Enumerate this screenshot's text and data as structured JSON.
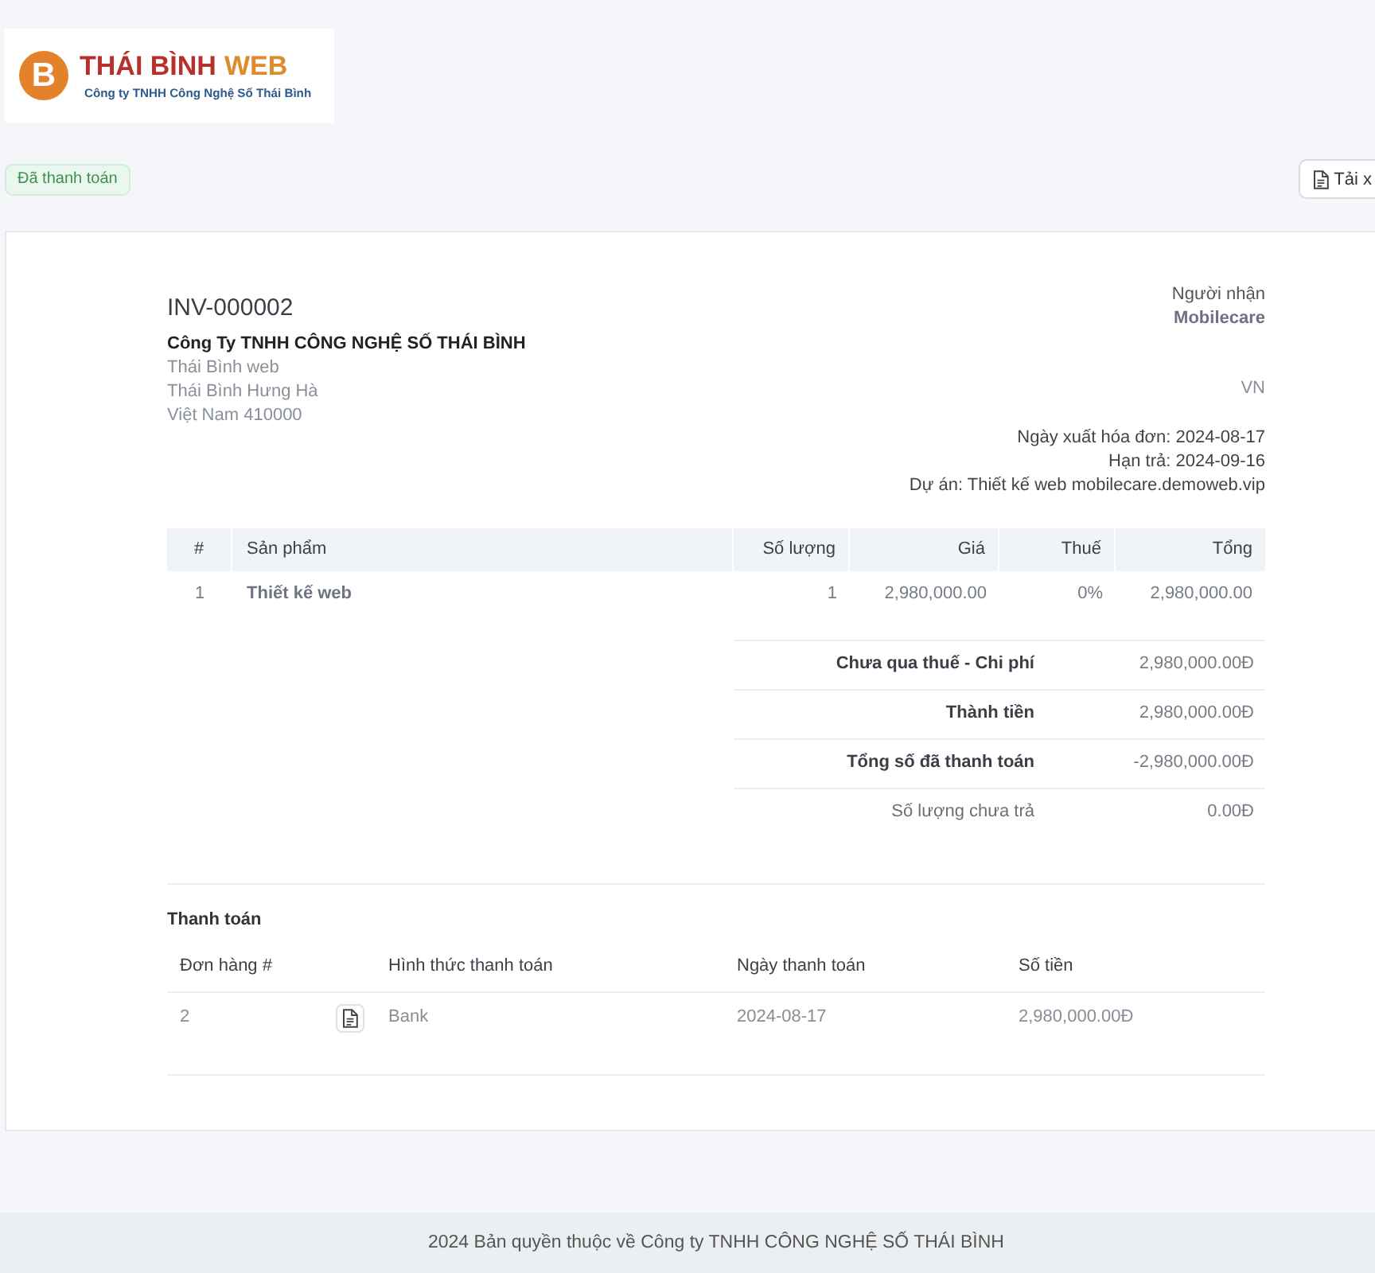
{
  "header": {
    "logo": {
      "mark": "B",
      "title": "THÁI BÌNH",
      "title_accent": "WEB",
      "tagline": "Công ty TNHH Công Nghệ Số Thái Bình"
    },
    "status_badge": "Đã thanh toán",
    "download_button": "Tải x"
  },
  "invoice": {
    "number": "INV-000002",
    "seller": {
      "name": "Công Ty TNHH CÔNG NGHỆ SỐ THÁI BÌNH",
      "address": [
        "Thái Bình web",
        "Thái Bình Hưng Hà",
        "Việt Nam 410000"
      ]
    },
    "recipient": {
      "label": "Người nhận",
      "name": "Mobilecare",
      "country": "VN"
    },
    "details": [
      {
        "label": "Ngày xuất hóa đơn:",
        "value": "2024-08-17"
      },
      {
        "label": "Hạn trả:",
        "value": "2024-09-16"
      },
      {
        "label": "Dự án:",
        "value": "Thiết kế web mobilecare.demoweb.vip"
      }
    ]
  },
  "items_table": {
    "columns": [
      "#",
      "Sản phẩm",
      "Số lượng",
      "Giá",
      "Thuế",
      "Tổng"
    ],
    "rows": [
      [
        "1",
        "Thiết kế web",
        "1",
        "2,980,000.00",
        "0%",
        "2,980,000.00"
      ]
    ]
  },
  "totals": [
    {
      "label": "Chưa qua thuế - Chi phí",
      "value": "2,980,000.00Đ",
      "emphasized": true
    },
    {
      "label": "Thành tiền",
      "value": "2,980,000.00Đ",
      "emphasized": true
    },
    {
      "label": "Tổng số đã thanh toán",
      "value": "-2,980,000.00Đ",
      "emphasized": true
    },
    {
      "label": "Số lượng chưa trả",
      "value": "0.00Đ",
      "emphasized": false
    }
  ],
  "payments": {
    "title": "Thanh toán",
    "columns": [
      "Đơn hàng #",
      "Hình thức thanh toán",
      "Ngày thanh toán",
      "Số tiền"
    ],
    "rows": [
      {
        "order": "2",
        "method": "Bank",
        "date": "2024-08-17",
        "amount": "2,980,000.00Đ"
      }
    ]
  },
  "footer": {
    "copyright": "2024 Bản quyền thuộc về Công ty TNHH CÔNG NGHỆ SỐ THÁI BÌNH"
  }
}
